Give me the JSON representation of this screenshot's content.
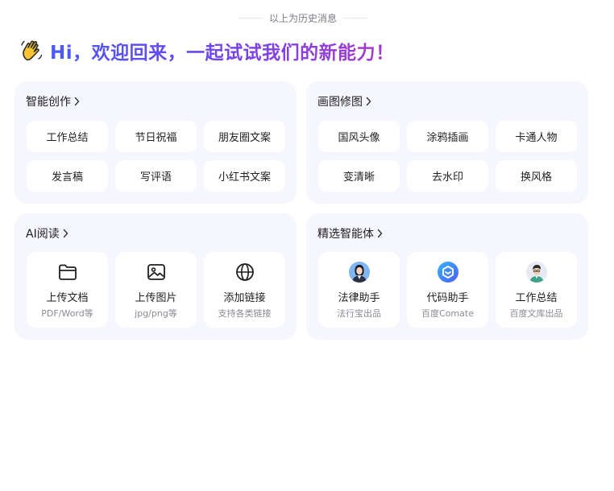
{
  "history_divider": "以上为历史消息",
  "greeting": "Hi，欢迎回来，一起试试我们的新能力！",
  "cards": {
    "creation": {
      "title": "智能创作",
      "chips": [
        "工作总结",
        "节日祝福",
        "朋友圈文案",
        "发言稿",
        "写评语",
        "小红书文案"
      ]
    },
    "image": {
      "title": "画图修图",
      "chips": [
        "国风头像",
        "涂鸦插画",
        "卡通人物",
        "变清晰",
        "去水印",
        "换风格"
      ]
    },
    "reading": {
      "title": "AI阅读",
      "tiles": [
        {
          "icon": "folder-icon",
          "title": "上传文档",
          "sub": "PDF/Word等"
        },
        {
          "icon": "image-icon",
          "title": "上传图片",
          "sub": "jpg/png等"
        },
        {
          "icon": "globe-icon",
          "title": "添加链接",
          "sub": "支持各类链接"
        }
      ]
    },
    "agents": {
      "title": "精选智能体",
      "tiles": [
        {
          "icon": "lawyer-avatar-icon",
          "title": "法律助手",
          "sub": "法行宝出品"
        },
        {
          "icon": "comate-logo-icon",
          "title": "代码助手",
          "sub": "百度Comate"
        },
        {
          "icon": "worker-avatar-icon",
          "title": "工作总结",
          "sub": "百度文库出品"
        }
      ]
    }
  },
  "colors": {
    "card_bg": "#f5f6fe",
    "gradient_start": "#4a5bf2",
    "gradient_end": "#a93ac9",
    "divider_text": "#7a7a85"
  }
}
